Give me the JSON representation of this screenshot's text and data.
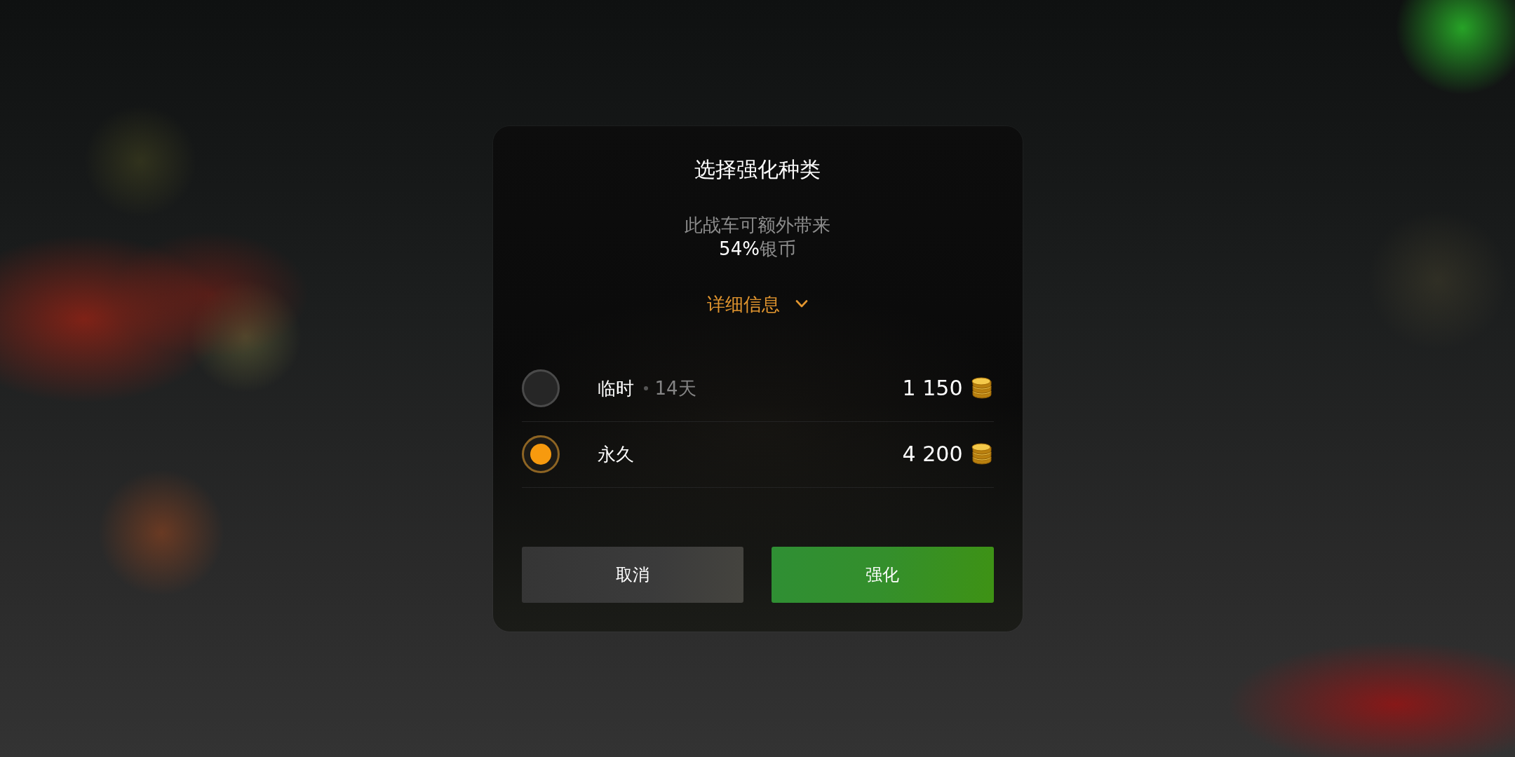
{
  "dialog": {
    "title": "选择强化种类",
    "description": {
      "lines": [
        "此战车可额外带来",
        "**54%**银币"
      ]
    },
    "details": {
      "label": "详细信息",
      "expanded": false
    },
    "options": [
      {
        "label": "临时",
        "duration": "14天",
        "price": "1 150",
        "selected": false
      },
      {
        "label": "永久",
        "price": "4 200",
        "selected": true
      }
    ],
    "buttons": [
      {
        "label": "取消",
        "kind": "secondary"
      },
      {
        "label": "强化",
        "kind": "primary"
      }
    ]
  }
}
